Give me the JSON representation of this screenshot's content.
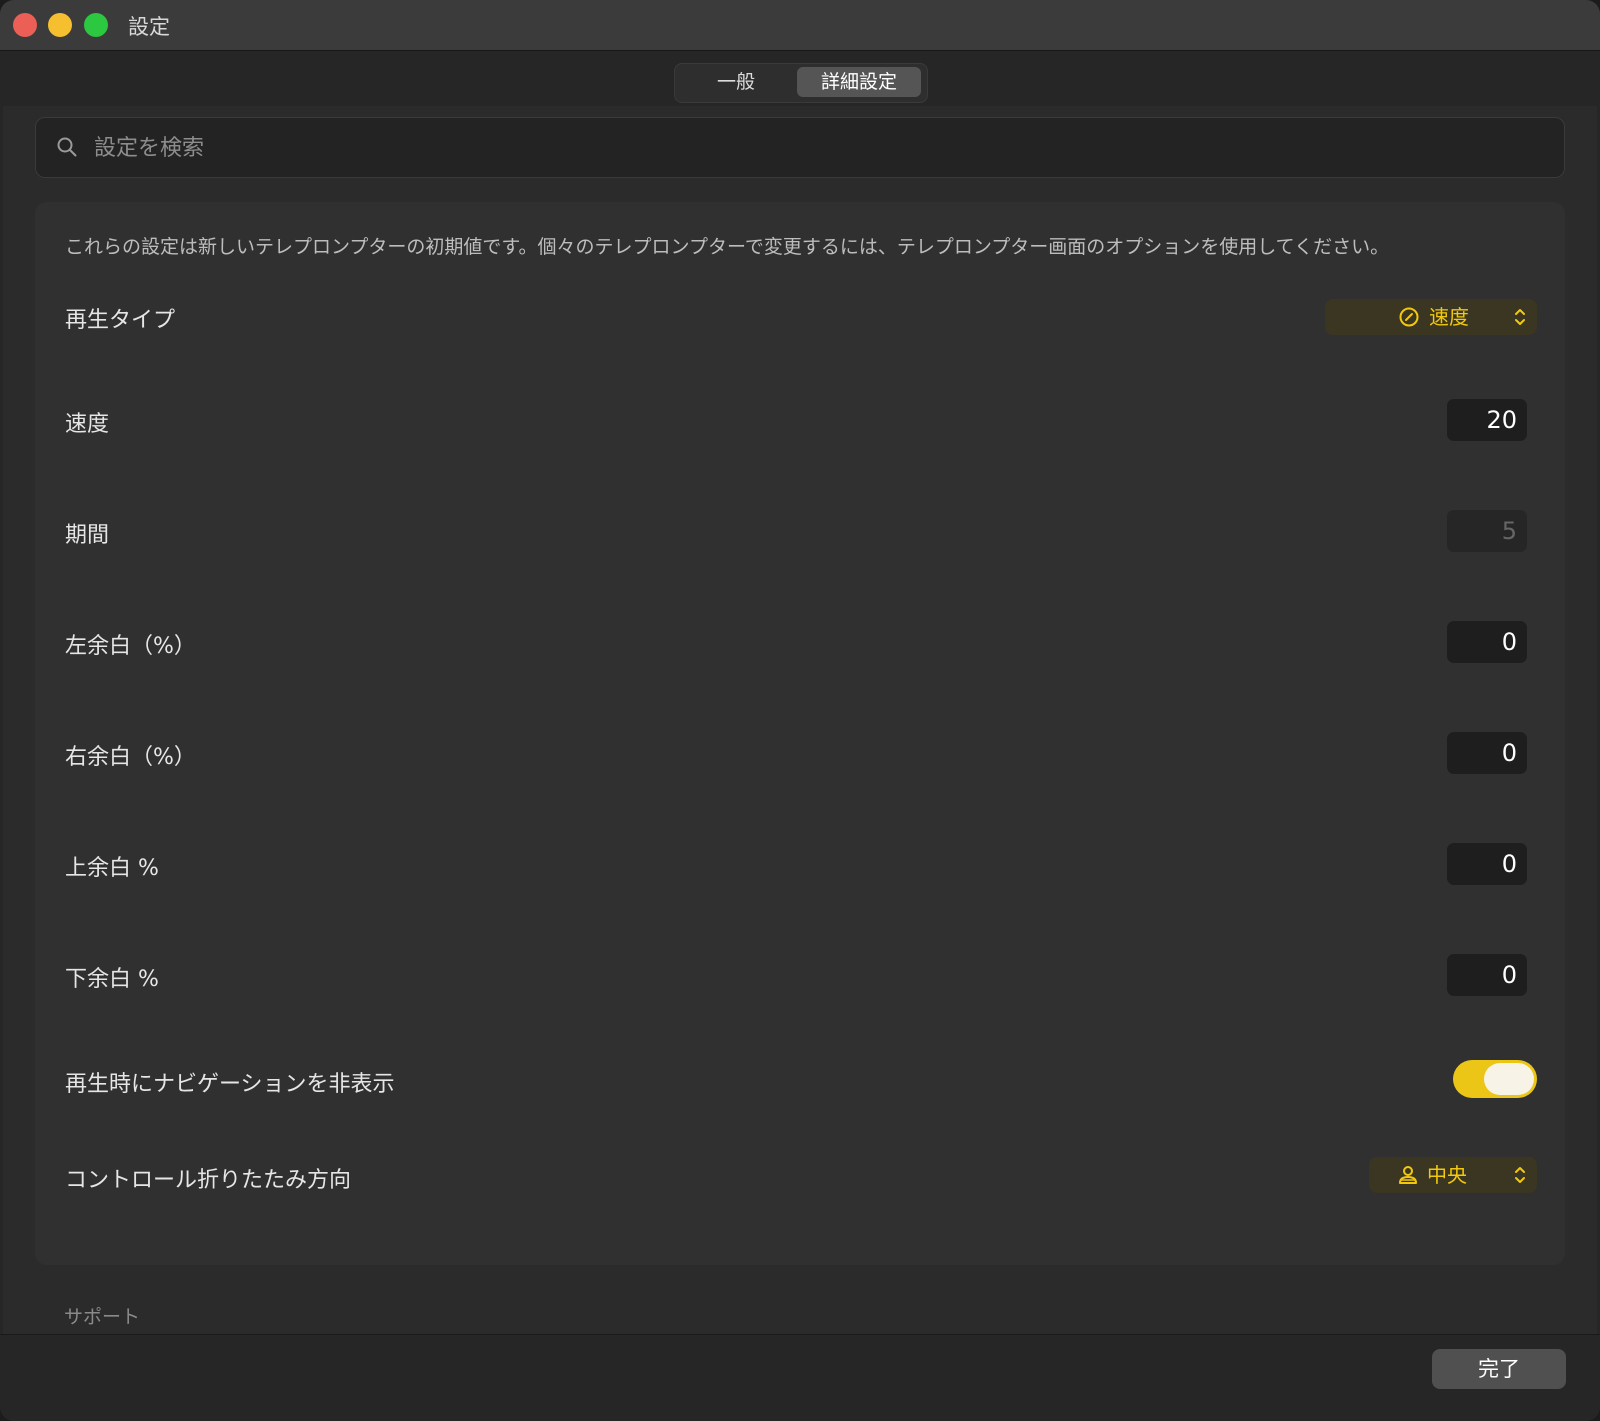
{
  "window": {
    "title": "設定"
  },
  "tabs": [
    {
      "label": "一般",
      "selected": false
    },
    {
      "label": "詳細設定",
      "selected": true
    }
  ],
  "search": {
    "placeholder": "設定を検索",
    "value": ""
  },
  "intro_text": "これらの設定は新しいテレプロンプターの初期値です。個々のテレプロンプターで変更するには、テレプロンプター画面のオプションを使用してください。",
  "settings": {
    "playback_type": {
      "label": "再生タイプ",
      "value": "速度",
      "icon": "speedometer-icon"
    },
    "speed": {
      "label": "速度",
      "value": "20"
    },
    "duration": {
      "label": "期間",
      "value": "5",
      "enabled": false
    },
    "left_margin": {
      "label": "左余白（%）",
      "value": "0"
    },
    "right_margin": {
      "label": "右余白（%）",
      "value": "0"
    },
    "top_margin": {
      "label": "上余白 %",
      "value": "0"
    },
    "bottom_margin": {
      "label": "下余白 %",
      "value": "0"
    },
    "hide_navigation": {
      "label": "再生時にナビゲーションを非表示",
      "on": true
    },
    "control_collapse": {
      "label": "コントロール折りたたみ方向",
      "value": "中央",
      "icon": "person-center-icon"
    }
  },
  "support_section": {
    "title": "サポート"
  },
  "footer": {
    "done_label": "完了"
  },
  "colors": {
    "accent": "#ecc616",
    "accent_text": "#f2c811",
    "background": "#262626",
    "panel": "#303030"
  }
}
